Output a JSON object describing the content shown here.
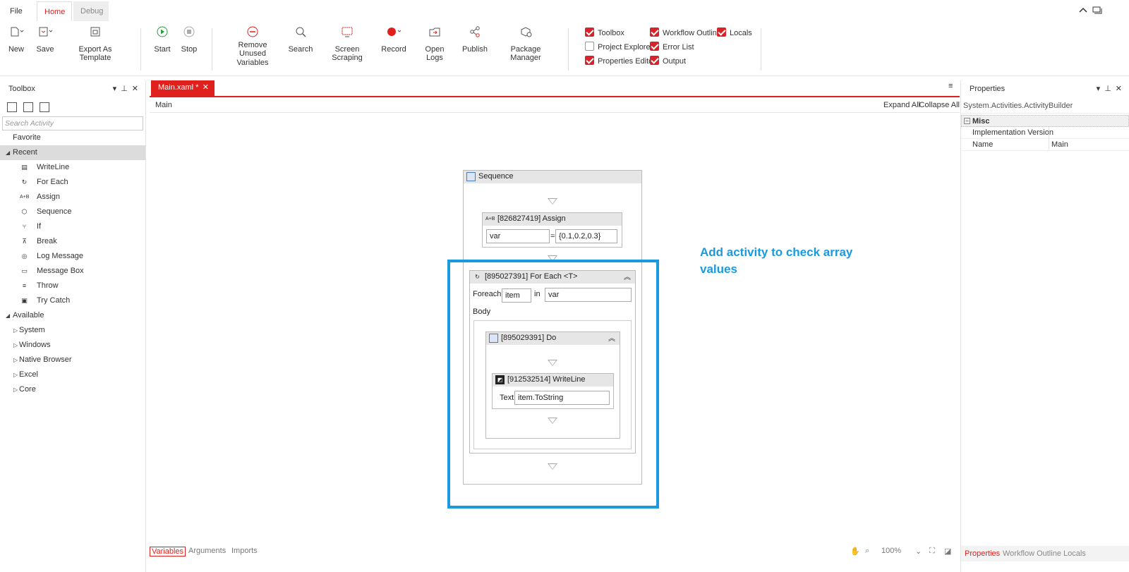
{
  "menu": {
    "file": "File",
    "home": "Home",
    "debug": "Debug"
  },
  "ribbon": {
    "new": "New",
    "save": "Save",
    "export_template": "Export As Template",
    "start": "Start",
    "stop": "Stop",
    "remove_unused_1": "Remove Unused",
    "remove_unused_2": "Variables",
    "search": "Search",
    "screen_scraping": "Screen Scraping",
    "record": "Record",
    "open_logs": "Open Logs",
    "publish": "Publish",
    "package_manager": "Package Manager",
    "panels": [
      {
        "label": "Toolbox",
        "checked": true
      },
      {
        "label": "Workflow Outline",
        "checked": true
      },
      {
        "label": "Locals",
        "checked": true
      },
      {
        "label": "Project Explorer",
        "checked": false
      },
      {
        "label": "Error List",
        "checked": true
      },
      {
        "label": "Properties Editor",
        "checked": true
      },
      {
        "label": "Output",
        "checked": true
      }
    ]
  },
  "toolbox": {
    "title": "Toolbox",
    "search_placeholder": "Search Activity",
    "favorite": "Favorite",
    "recent": "Recent",
    "recent_items": [
      "WriteLine",
      "For Each",
      "Assign",
      "Sequence",
      "If",
      "Break",
      "Log Message",
      "Message Box",
      "Throw",
      "Try Catch"
    ],
    "available": "Available",
    "available_items": [
      "System",
      "Windows",
      "Native Browser",
      "Excel",
      "Core"
    ]
  },
  "designer": {
    "tab_label": "Main.xaml *",
    "breadcrumb": "Main",
    "expand_all": "Expand All",
    "collapse_all": "Collapse All",
    "sequence_title": "Sequence",
    "assign_title": "[826827419] Assign",
    "assign_to": "var",
    "assign_value": "{0.1,0.2,0.3}",
    "foreach_title": "[895027391] For Each <T>",
    "foreach_label": "Foreach",
    "foreach_item": "item",
    "in_label": "in",
    "foreach_values": "var",
    "body_label": "Body",
    "do_title": "[895029391] Do",
    "writeline_title": "[912532514] WriteLine",
    "text_label": "Text",
    "text_value": "item.ToString",
    "annotation": "Add activity to check array values"
  },
  "bottom": {
    "variables": "Variables",
    "arguments": "Arguments",
    "imports": "Imports",
    "zoom": "100%"
  },
  "properties": {
    "title": "Properties",
    "type": "System.Activities.ActivityBuilder",
    "category": "Misc",
    "rows": [
      {
        "key": "Implementation Version",
        "value": ""
      },
      {
        "key": "Name",
        "value": "Main"
      }
    ],
    "tabs": [
      "Properties",
      "Workflow Outline",
      "Locals"
    ]
  },
  "colors": {
    "accent": "#e0201c",
    "annotation": "#1a9ade"
  }
}
